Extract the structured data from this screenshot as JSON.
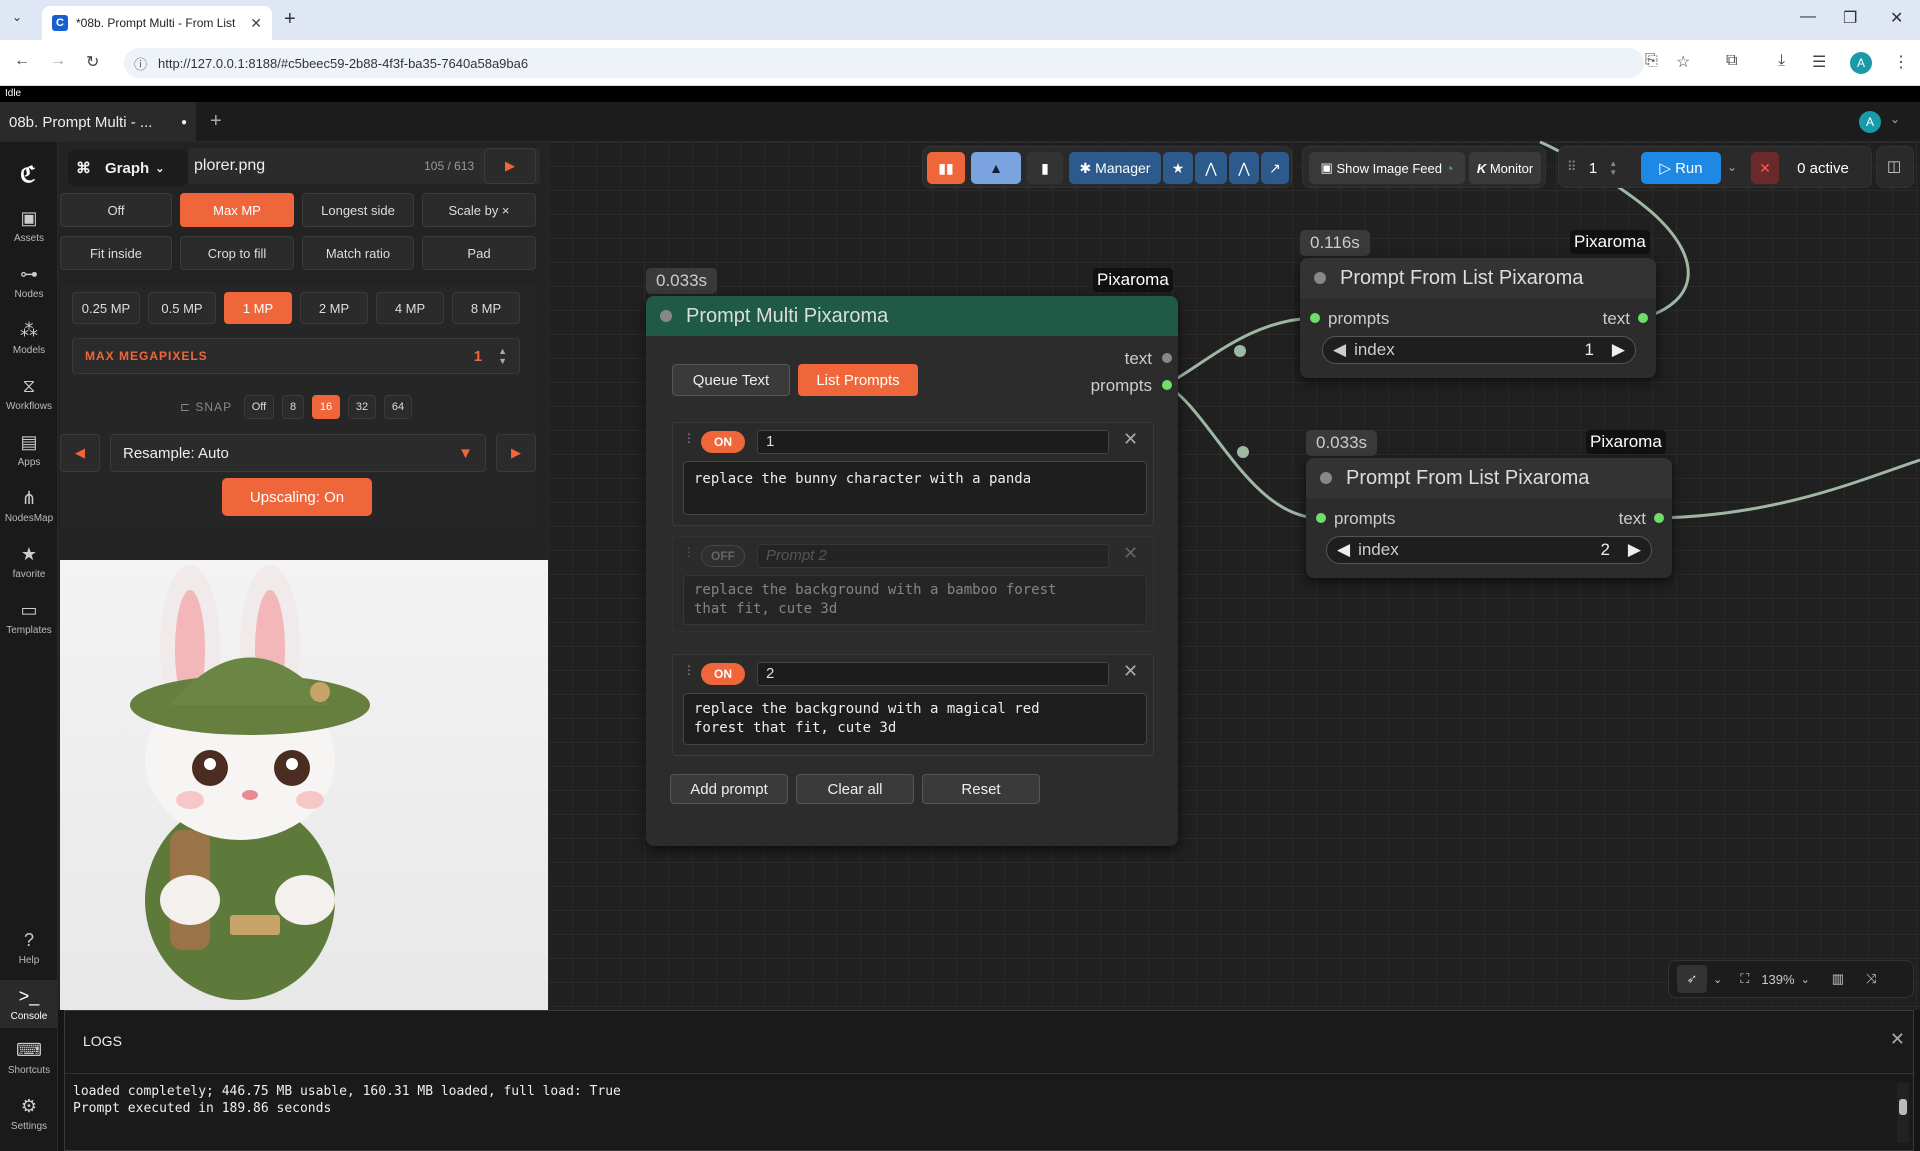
{
  "browser": {
    "tab_title": "*08b. Prompt Multi - From List",
    "url": "http://127.0.0.1:8188/#c5beec59-2b88-4f3f-ba35-7640a58a9ba6",
    "profile_initial": "A"
  },
  "app": {
    "status": "Idle",
    "workflow_tab": "08b. Prompt Multi - ...",
    "user_initial": "A"
  },
  "sidebar": {
    "items": [
      {
        "label": "Assets",
        "icon": "image-icon"
      },
      {
        "label": "Nodes",
        "icon": "nodes-icon"
      },
      {
        "label": "Models",
        "icon": "models-icon"
      },
      {
        "label": "Workflows",
        "icon": "workflows-icon"
      },
      {
        "label": "Apps",
        "icon": "apps-icon"
      },
      {
        "label": "NodesMap",
        "icon": "nodesmap-icon"
      },
      {
        "label": "favorite",
        "icon": "star-icon"
      },
      {
        "label": "Templates",
        "icon": "templates-icon"
      }
    ],
    "bottom": [
      {
        "label": "Help",
        "icon": "help-icon"
      },
      {
        "label": "Console",
        "icon": "console-icon"
      },
      {
        "label": "Shortcuts",
        "icon": "keyboard-icon"
      },
      {
        "label": "Settings",
        "icon": "gear-icon"
      }
    ]
  },
  "left_panel": {
    "graph_label": "Graph",
    "file_name": "plorer.png",
    "file_counter": "105 / 613",
    "fit_modes": [
      "Off",
      "Max MP",
      "Longest side",
      "Scale by ×",
      "Fit inside",
      "Crop to fill",
      "Match ratio",
      "Pad"
    ],
    "fit_selected": "Max MP",
    "mp_options": [
      "0.25 MP",
      "0.5 MP",
      "1 MP",
      "2 MP",
      "4 MP",
      "8 MP"
    ],
    "mp_selected": "1 MP",
    "max_mp_label": "MAX MEGAPIXELS",
    "max_mp_value": "1",
    "snap_label": "SNAP",
    "snap_options": [
      "Off",
      "8",
      "16",
      "32",
      "64"
    ],
    "snap_selected": "16",
    "resample": "Resample: Auto",
    "upscaling": "Upscaling: On"
  },
  "toolbar": {
    "manager": "Manager",
    "image_feed": "Show Image Feed",
    "monitor": "Monitor",
    "batch": "1",
    "run": "Run",
    "active": "0 active"
  },
  "node_multi": {
    "timer": "0.033s",
    "badge": "Pixaroma",
    "title": "Prompt Multi Pixaroma",
    "tab_queue": "Queue Text",
    "tab_list": "List Prompts",
    "out_text": "text",
    "out_prompts": "prompts",
    "prompts": [
      {
        "state": "ON",
        "name": "1",
        "placeholder": "",
        "text": "replace the bunny character with a panda"
      },
      {
        "state": "OFF",
        "name": "",
        "placeholder": "Prompt 2",
        "text": "replace the background with a bamboo forest\nthat fit, cute 3d"
      },
      {
        "state": "ON",
        "name": "2",
        "placeholder": "",
        "text": "replace the background with a magical red\nforest that fit, cute 3d"
      }
    ],
    "btn_add": "Add prompt",
    "btn_clear": "Clear all",
    "btn_reset": "Reset"
  },
  "node_list1": {
    "timer": "0.116s",
    "badge": "Pixaroma",
    "title": "Prompt From List Pixaroma",
    "in_prompts": "prompts",
    "out_text": "text",
    "index_label": "index",
    "index_value": "1"
  },
  "node_list2": {
    "timer": "0.033s",
    "badge": "Pixaroma",
    "title": "Prompt From List Pixaroma",
    "in_prompts": "prompts",
    "out_text": "text",
    "index_label": "index",
    "index_value": "2"
  },
  "canvas_controls": {
    "zoom": "139%"
  },
  "logs": {
    "title": "LOGS",
    "lines": [
      "loaded completely; 446.75 MB usable, 160.31 MB loaded, full load: True",
      "Prompt executed in 189.86 seconds"
    ]
  },
  "colors": {
    "accent": "#f0663b",
    "node_header": "#1e5a45",
    "link": "#9fb8a4",
    "run": "#1e88e5"
  }
}
